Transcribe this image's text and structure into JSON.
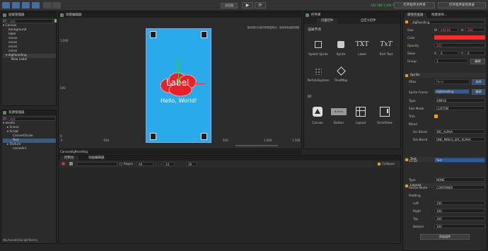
{
  "toolbar": {
    "play_label": "▶",
    "refresh_label": "⟳",
    "device": "浏览器",
    "ip": "192.168.1.100:7456",
    "open_folder": "打开程序文件夹",
    "open_editor": "打开程序安装目录"
  },
  "hierarchy": {
    "title": "层级管理器",
    "search_placeholder": "搜索",
    "items": [
      "Canvas",
      "background",
      "label",
      "cocos",
      "cocos",
      "cocos",
      "cocos",
      "digPanelling",
      "New Label"
    ]
  },
  "assets": {
    "title": "资源管理器",
    "search_placeholder": "搜索",
    "items": [
      "assets",
      "Scene",
      "Script",
      "ConvertScale",
      "Test",
      "Texture",
      "cocosAni"
    ],
    "footer": "db://assets/Script/Test.ts"
  },
  "scene": {
    "title": "场景编辑器",
    "hint": "使用鼠标右键平移视窗焦点，使用滚轮缩放视图",
    "y_labels": [
      "1,000",
      "500",
      "0"
    ],
    "x_labels": [
      "0",
      "-500",
      "500",
      "1,000",
      "1,500"
    ],
    "label_text": "Label",
    "hello_text": "Hello, World!",
    "canvas_color": "#29aaea"
  },
  "timeline": {
    "tab1": "CanvasdigPanelling",
    "tab2": "动画编辑器"
  },
  "console": {
    "tab1": "控制台",
    "tab2": "动画编辑器",
    "regex": "Regex",
    "level": "All",
    "font_size": "14",
    "lines": "30",
    "collapse": "Collapse"
  },
  "components": {
    "title": "控件库",
    "tab_builtin": "内置控件",
    "tab_custom": "自定义控件",
    "render_header": "渲染节点",
    "items_row1": [
      "Splash Sprite",
      "Sprite",
      "Label",
      "Rich Text"
    ],
    "items_row2": [
      "ParticleSystem",
      "TiledMap"
    ],
    "ui_header": "UI",
    "items_row3": [
      "Canvas",
      "Button",
      "Layout",
      "ScrollView"
    ]
  },
  "inspector": {
    "title": "属性检查器",
    "tab2": "构建发布...",
    "node_name": "digPanelling",
    "size": {
      "label": "Size",
      "w_label": "W",
      "w": "444.66",
      "h_label": "H",
      "h": "300"
    },
    "color": {
      "label": "Color",
      "value": "#ff2a2a"
    },
    "opacity": {
      "label": "Opacity",
      "value": "255"
    },
    "skew": {
      "label": "Skew",
      "x": "0",
      "y": "0"
    },
    "group": {
      "label": "Group",
      "value": "1",
      "edit": "编辑"
    },
    "sprite": {
      "header": "Sprite",
      "atlas_label": "Atlas",
      "atlas_value": "None",
      "atlas_btn": "选择",
      "frame_label": "Sprite Frame",
      "frame_value": "digPanelling",
      "frame_btn": "编辑",
      "type_label": "Type",
      "type_value": "SIMPLE",
      "size_mode_label": "Size Mode",
      "size_mode_value": "CUSTOM",
      "trim_label": "Trim",
      "blend_label": "Blend",
      "src_label": "Src Blend",
      "src_value": "SRC_ALPHA",
      "dst_label": "Dst Blend",
      "dst_value": "ONE_MINUS_SRC_ALPHA"
    },
    "test": {
      "header": "Test",
      "script_label": "Script",
      "script_value": "Test"
    },
    "layout": {
      "header": "Layout",
      "type_label": "Type",
      "type_value": "NONE",
      "resize_label": "Resize Mode",
      "resize_value": "CONTAINER",
      "padding_label": "Padding",
      "left_label": "Left",
      "left": "100",
      "right_label": "Right",
      "right": "100",
      "top_label": "Top",
      "top": "100",
      "bottom_label": "Bottom",
      "bottom": "100"
    },
    "add_component": "添加组件"
  }
}
